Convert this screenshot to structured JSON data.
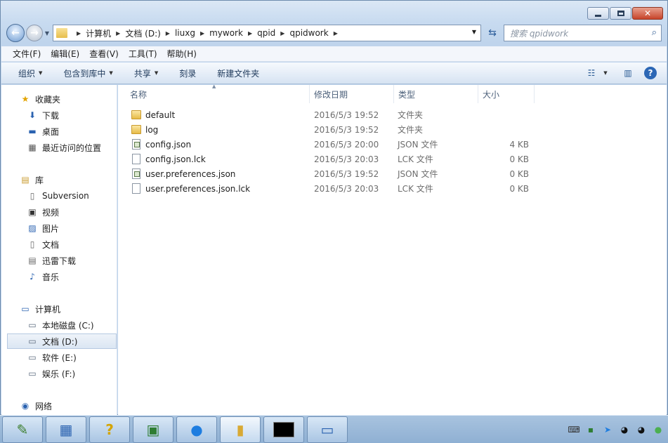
{
  "window": {
    "caption_buttons": [
      "minimize",
      "maximize",
      "close"
    ]
  },
  "address_bar": {
    "breadcrumbs": [
      "计算机",
      "文档 (D:)",
      "liuxg",
      "mywork",
      "qpid",
      "qpidwork"
    ]
  },
  "search": {
    "placeholder": "搜索 qpidwork"
  },
  "menu": [
    "文件(F)",
    "编辑(E)",
    "查看(V)",
    "工具(T)",
    "帮助(H)"
  ],
  "commands": [
    "组织",
    "包含到库中",
    "共享",
    "刻录",
    "新建文件夹"
  ],
  "nav": {
    "favorites_header": "收藏夹",
    "favorites": [
      "下载",
      "桌面",
      "最近访问的位置"
    ],
    "libraries_header": "库",
    "libraries": [
      "Subversion",
      "视频",
      "图片",
      "文档",
      "迅雷下载",
      "音乐"
    ],
    "computer_header": "计算机",
    "drives": [
      "本地磁盘 (C:)",
      "文档 (D:)",
      "软件 (E:)",
      "娱乐 (F:)"
    ],
    "network_header": "网络",
    "selected": "文档 (D:)"
  },
  "columns": [
    "名称",
    "修改日期",
    "类型",
    "大小"
  ],
  "files": [
    {
      "name": "default",
      "date": "2016/5/3 19:52",
      "type": "文件夹",
      "size": "",
      "icon": "folder-icon"
    },
    {
      "name": "log",
      "date": "2016/5/3 19:52",
      "type": "文件夹",
      "size": "",
      "icon": "folder-icon"
    },
    {
      "name": "config.json",
      "date": "2016/5/3 20:00",
      "type": "JSON 文件",
      "size": "4 KB",
      "icon": "json-file-icon"
    },
    {
      "name": "config.json.lck",
      "date": "2016/5/3 20:03",
      "type": "LCK 文件",
      "size": "0 KB",
      "icon": "file-icon"
    },
    {
      "name": "user.preferences.json",
      "date": "2016/5/3 19:52",
      "type": "JSON 文件",
      "size": "0 KB",
      "icon": "json-file-icon"
    },
    {
      "name": "user.preferences.json.lck",
      "date": "2016/5/3 20:03",
      "type": "LCK 文件",
      "size": "0 KB",
      "icon": "file-icon"
    }
  ],
  "taskbar": [
    "notepad-icon",
    "control-panel-icon",
    "help-icon",
    "monitor-icon",
    "feishu-icon",
    "explorer-icon",
    "cmd-icon",
    "network-icon"
  ]
}
